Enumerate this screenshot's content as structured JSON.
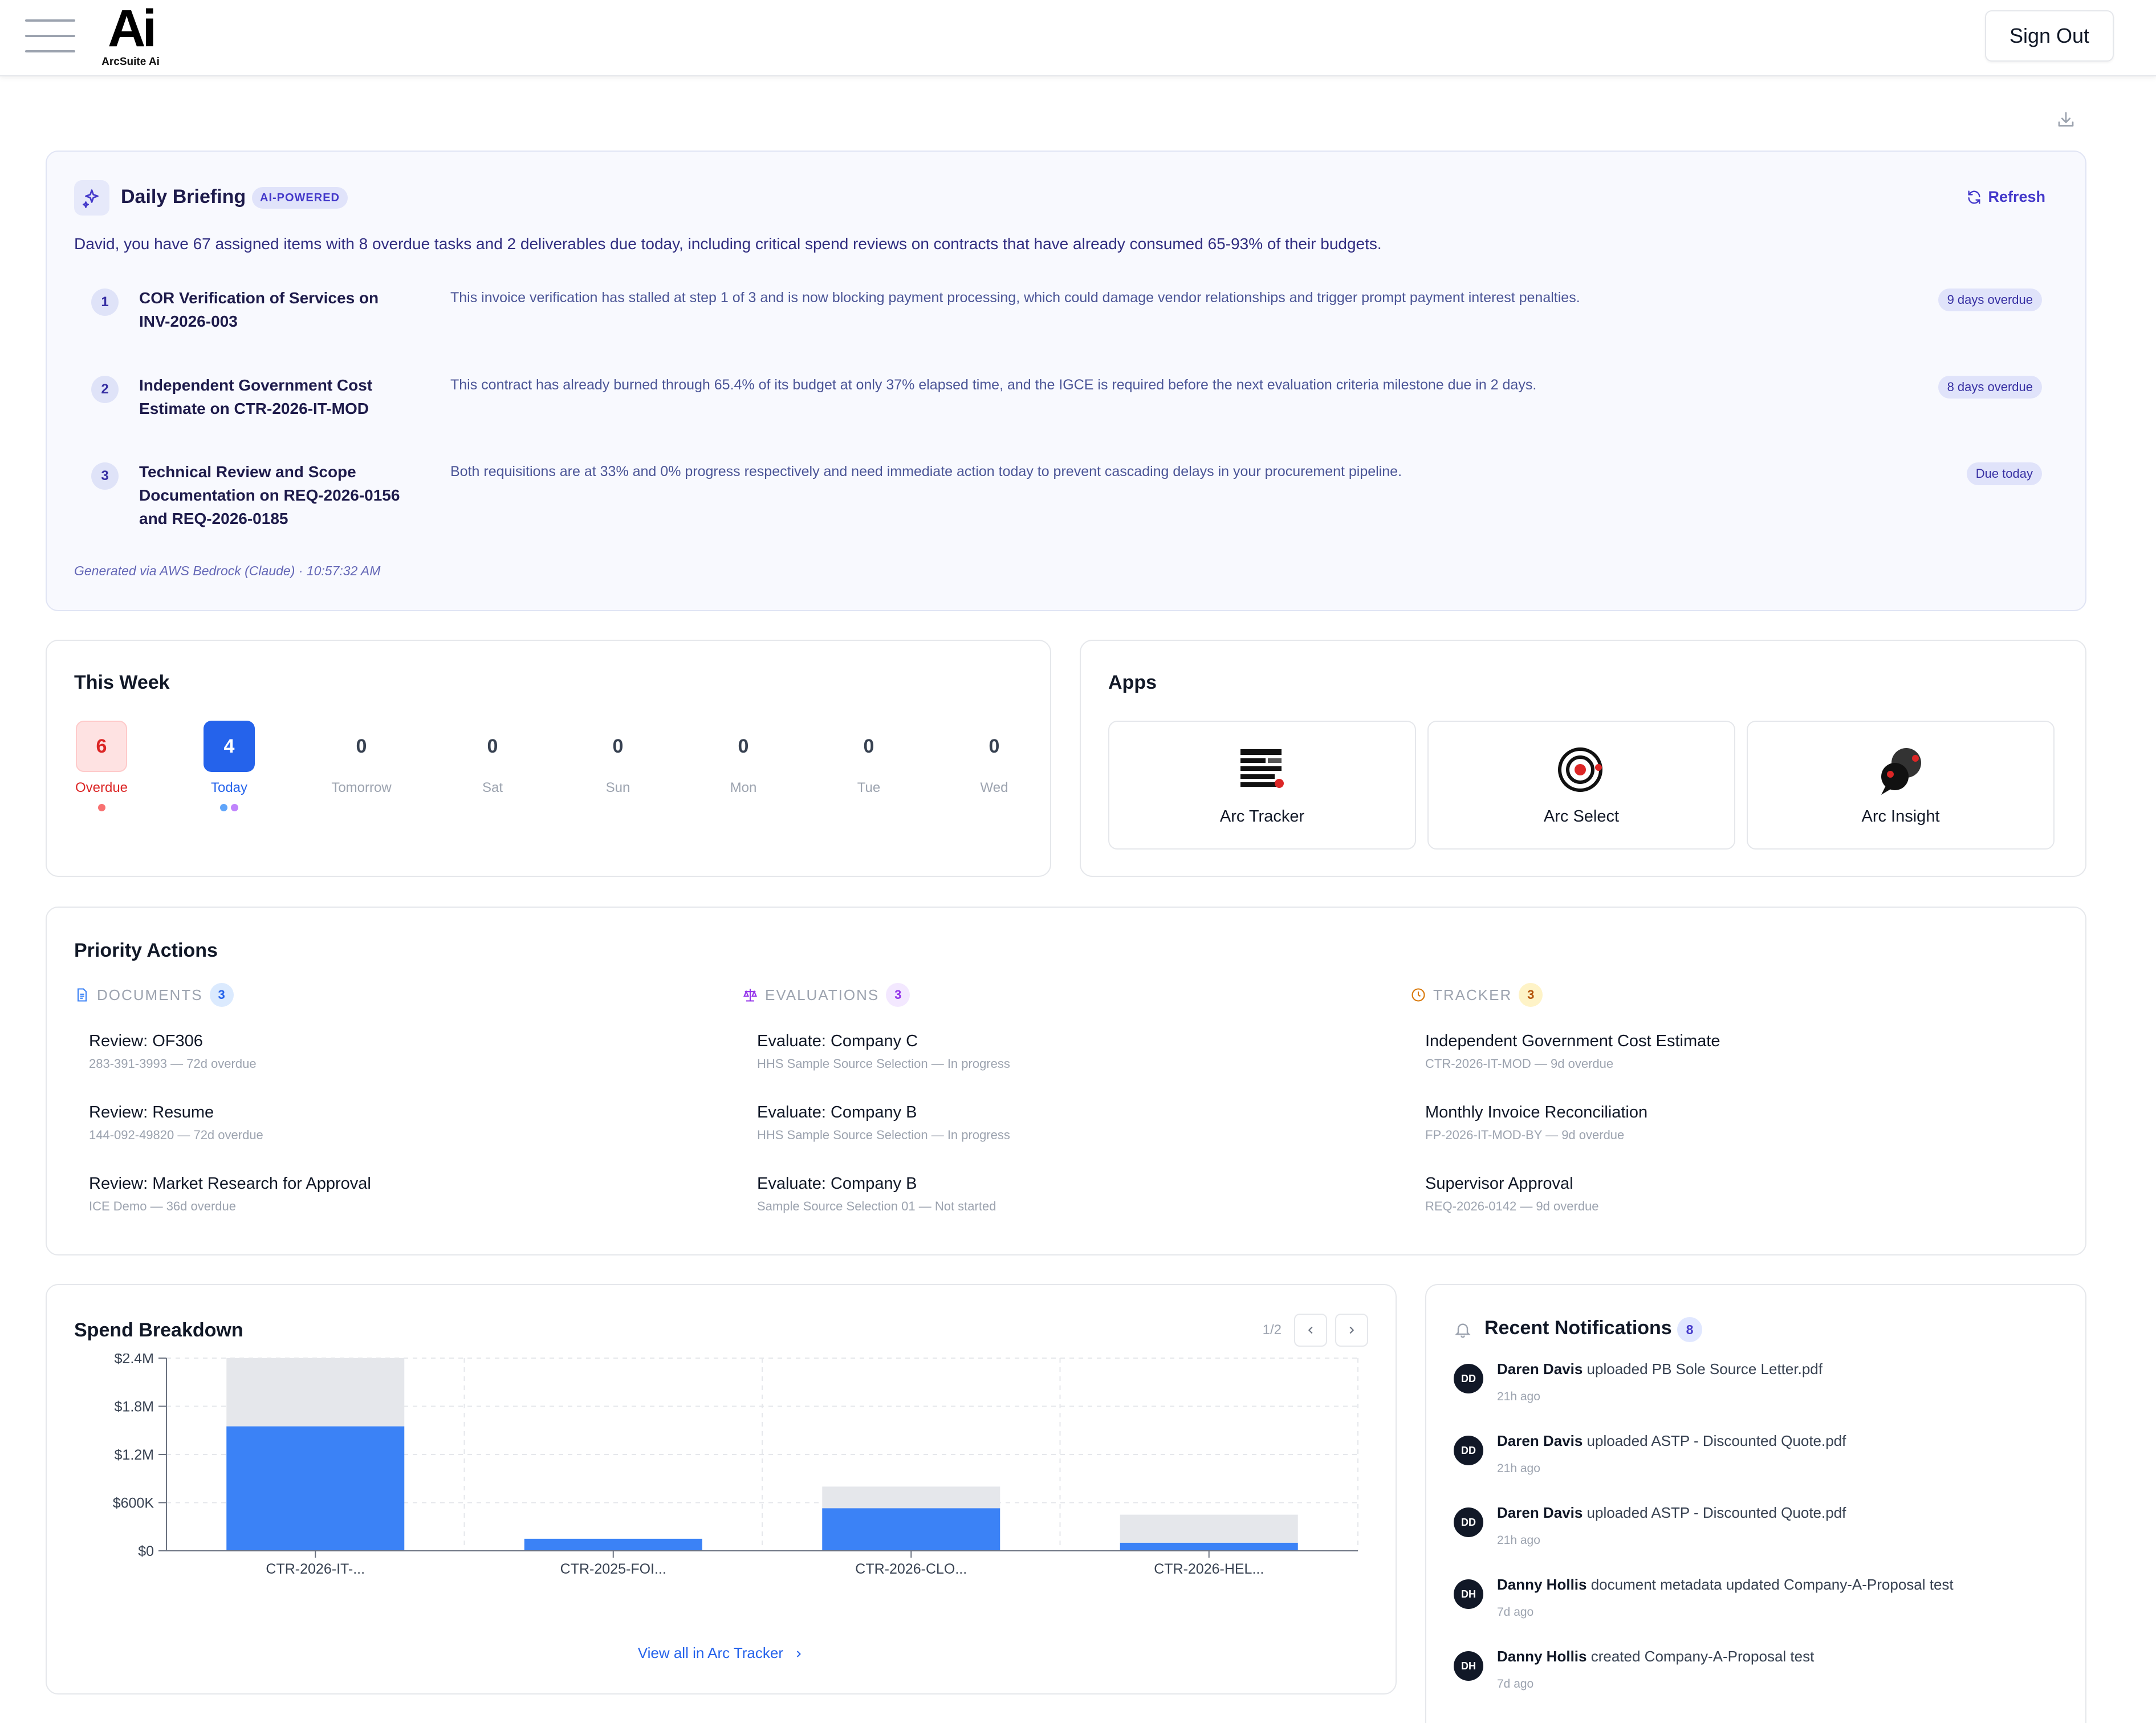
{
  "header": {
    "logo_mark": "Ai",
    "logo_text": "ArcSuite Ai",
    "sign_out": "Sign Out"
  },
  "briefing": {
    "title": "Daily Briefing",
    "badge": "AI-POWERED",
    "refresh": "Refresh",
    "summary": "David, you have 67 assigned items with 8 overdue tasks and 2 deliverables due today, including critical spend reviews on contracts that have already consumed 65-93% of their budgets.",
    "items": [
      {
        "num": "1",
        "title": "COR Verification of Services on INV-2026-003",
        "desc": "This invoice verification has stalled at step 1 of 3 and is now blocking payment processing, which could damage vendor relationships and trigger prompt payment interest penalties.",
        "tag": "9 days overdue"
      },
      {
        "num": "2",
        "title": "Independent Government Cost Estimate on CTR-2026-IT-MOD",
        "desc": "This contract has already burned through 65.4% of its budget at only 37% elapsed time, and the IGCE is required before the next evaluation criteria milestone due in 2 days.",
        "tag": "8 days overdue"
      },
      {
        "num": "3",
        "title": "Technical Review and Scope Documentation on REQ-2026-0156 and REQ-2026-0185",
        "desc": "Both requisitions are at 33% and 0% progress respectively and need immediate action today to prevent cascading delays in your procurement pipeline.",
        "tag": "Due today"
      }
    ],
    "footer": "Generated via AWS Bedrock (Claude) · 10:57:32 AM"
  },
  "week": {
    "title": "This Week",
    "days": [
      {
        "count": "6",
        "label": "Overdue"
      },
      {
        "count": "4",
        "label": "Today"
      },
      {
        "count": "0",
        "label": "Tomorrow"
      },
      {
        "count": "0",
        "label": "Sat"
      },
      {
        "count": "0",
        "label": "Sun"
      },
      {
        "count": "0",
        "label": "Mon"
      },
      {
        "count": "0",
        "label": "Tue"
      },
      {
        "count": "0",
        "label": "Wed"
      }
    ]
  },
  "apps": {
    "title": "Apps",
    "items": [
      {
        "label": "Arc Tracker",
        "icon": "tracker-icon"
      },
      {
        "label": "Arc Select",
        "icon": "target-icon"
      },
      {
        "label": "Arc Insight",
        "icon": "chat-bubbles-icon"
      }
    ]
  },
  "priority": {
    "title": "Priority Actions",
    "documents": {
      "label": "DOCUMENTS",
      "count": "3",
      "items": [
        {
          "title": "Review: OF306",
          "sub": "283-391-3993 — 72d overdue"
        },
        {
          "title": "Review: Resume",
          "sub": "144-092-49820 — 72d overdue"
        },
        {
          "title": "Review: Market Research for Approval",
          "sub": "ICE Demo — 36d overdue"
        }
      ]
    },
    "evaluations": {
      "label": "EVALUATIONS",
      "count": "3",
      "items": [
        {
          "title": "Evaluate: Company C",
          "sub": "HHS Sample Source Selection — In progress"
        },
        {
          "title": "Evaluate: Company B",
          "sub": "HHS Sample Source Selection — In progress"
        },
        {
          "title": "Evaluate: Company B",
          "sub": "Sample Source Selection 01 — Not started"
        }
      ]
    },
    "tracker": {
      "label": "TRACKER",
      "count": "3",
      "items": [
        {
          "title": "Independent Government Cost Estimate",
          "sub": "CTR-2026-IT-MOD — 9d overdue"
        },
        {
          "title": "Monthly Invoice Reconciliation",
          "sub": "FP-2026-IT-MOD-BY — 9d overdue"
        },
        {
          "title": "Supervisor Approval",
          "sub": "REQ-2026-0142 — 9d overdue"
        }
      ]
    }
  },
  "spend": {
    "title": "Spend Breakdown",
    "pager": "1/2",
    "view_all": "View all in Arc Tracker"
  },
  "chart_data": {
    "type": "bar",
    "categories": [
      "CTR-2026-IT-...",
      "CTR-2025-FOI...",
      "CTR-2026-CLO...",
      "CTR-2026-HEL..."
    ],
    "series": [
      {
        "values": [
          1550000,
          150000,
          530000,
          100000
        ],
        "color": "#3b82f6"
      },
      {
        "values": [
          2400000,
          150000,
          800000,
          450000
        ],
        "color": "#e5e7eb"
      }
    ],
    "ylim": [
      0,
      2400000
    ],
    "yticks": [
      "$0",
      "$600K",
      "$1.2M",
      "$1.8M",
      "$2.4M"
    ],
    "grid": true
  },
  "notifications": {
    "title": "Recent Notifications",
    "count": "8",
    "items": [
      {
        "initials": "DD",
        "name": "Daren Davis",
        "action": "uploaded PB Sole Source Letter.pdf",
        "time": "21h ago"
      },
      {
        "initials": "DD",
        "name": "Daren Davis",
        "action": "uploaded ASTP - Discounted Quote.pdf",
        "time": "21h ago"
      },
      {
        "initials": "DD",
        "name": "Daren Davis",
        "action": "uploaded ASTP - Discounted Quote.pdf",
        "time": "21h ago"
      },
      {
        "initials": "DH",
        "name": "Danny Hollis",
        "action": "document metadata updated Company-A-Proposal test",
        "time": "7d ago"
      },
      {
        "initials": "DH",
        "name": "Danny Hollis",
        "action": "created Company-A-Proposal test",
        "time": "7d ago"
      }
    ]
  }
}
